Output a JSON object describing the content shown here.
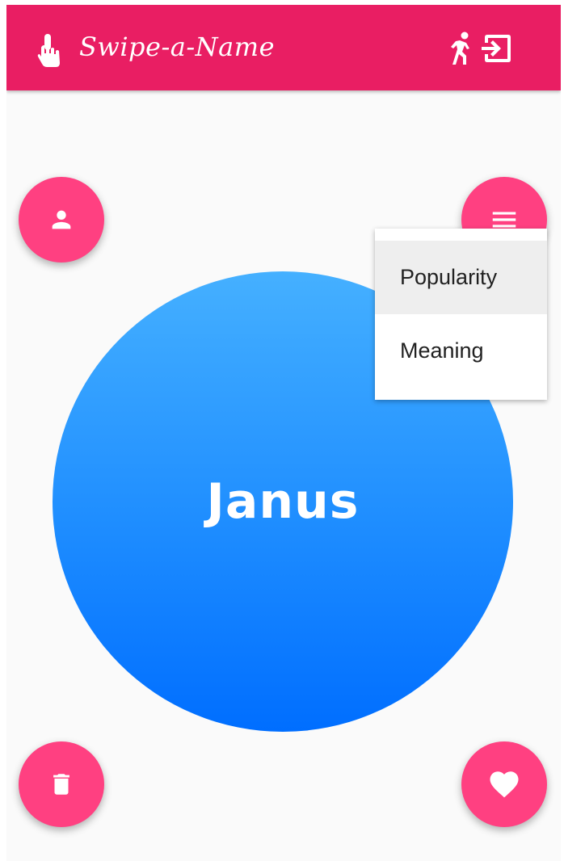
{
  "app": {
    "title": "Swipe-a-Name",
    "brand_icon": "touch-app-icon",
    "accent_color": "#e91e63",
    "fab_color": "#ff4081"
  },
  "toolbar": {
    "icons": [
      "directions-run-icon",
      "exit-to-app-icon"
    ]
  },
  "card": {
    "name": "Janus",
    "gradient_colors": [
      "#45b0ff",
      "#006eff"
    ]
  },
  "actions": {
    "profile_icon": "person-icon",
    "sort_icon": "menu-icon",
    "discard_icon": "trash-icon",
    "like_icon": "heart-icon"
  },
  "sort_menu": {
    "items": [
      {
        "label": "Popularity",
        "selected": true
      },
      {
        "label": "Meaning",
        "selected": false
      }
    ]
  }
}
